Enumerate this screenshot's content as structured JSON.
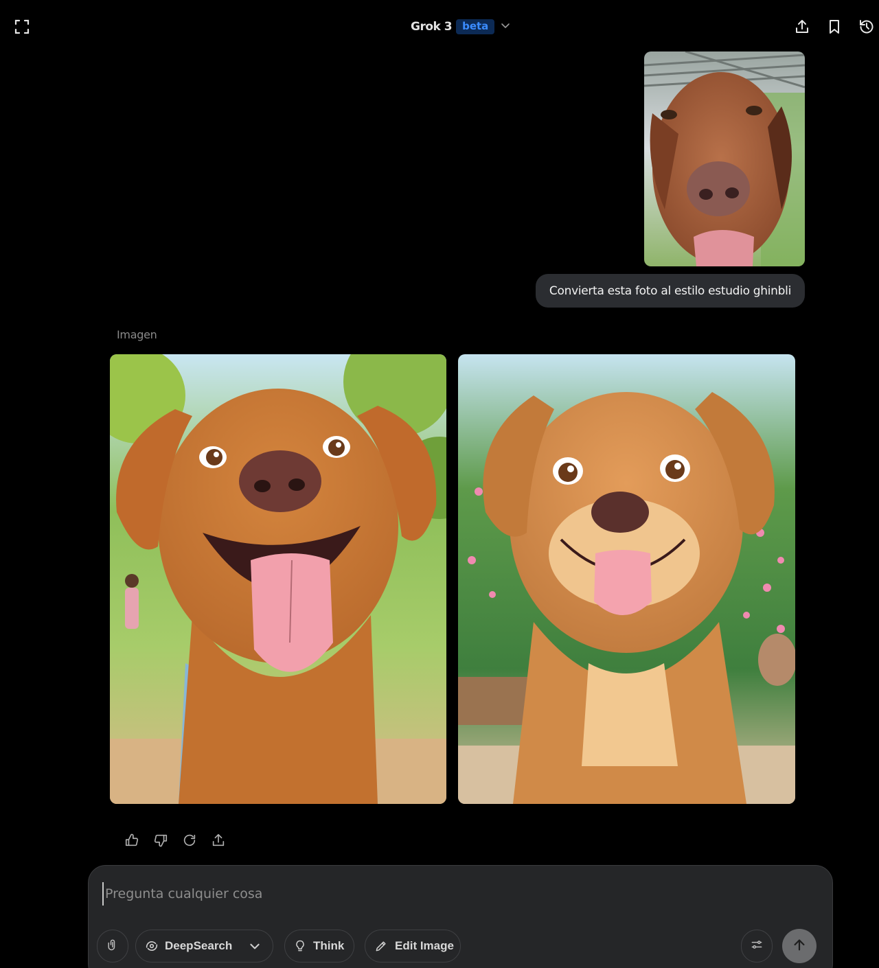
{
  "header": {
    "title": "Grok 3",
    "badge": "beta",
    "icons": [
      "expand-icon",
      "chevron-down-icon",
      "share-icon",
      "bookmark-icon",
      "history-icon"
    ]
  },
  "conversation": {
    "user_message": "Convierta esta foto al estilo estudio ghinbli",
    "user_attachment": "dog-photo",
    "assistant_label": "Imagen",
    "generated_images": [
      "ghibli-dog-1",
      "ghibli-dog-2"
    ],
    "actions": [
      "thumbs-up-icon",
      "thumbs-down-icon",
      "regenerate-icon",
      "share-icon"
    ]
  },
  "composer": {
    "placeholder": "Pregunta cualquier cosa",
    "value": "",
    "tools": {
      "deepsearch": "DeepSearch",
      "think": "Think",
      "edit_image": "Edit Image"
    }
  },
  "colors": {
    "background": "#000000",
    "bubble": "#2b2d31",
    "composer": "#252628",
    "badge_bg": "#0c2a55",
    "badge_fg": "#3b8cff"
  }
}
